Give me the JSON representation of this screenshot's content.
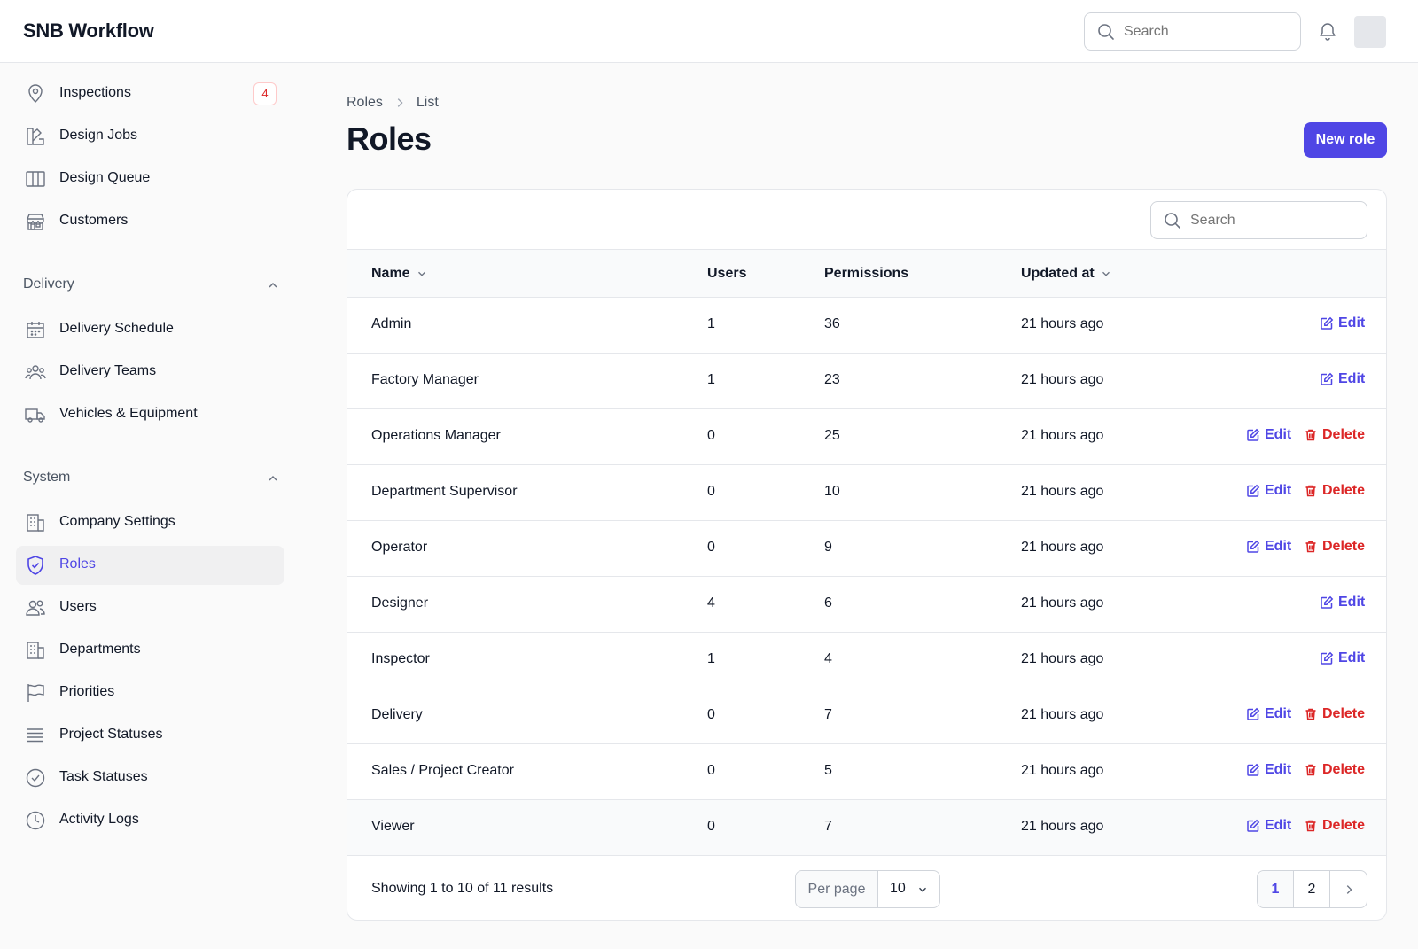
{
  "app": {
    "title": "SNB Workflow"
  },
  "header": {
    "search_placeholder": "Search"
  },
  "sidebar": {
    "items": [
      {
        "label": "Inspections",
        "icon": "map-pin-icon",
        "badge": "4"
      },
      {
        "label": "Design Jobs",
        "icon": "design-icon"
      },
      {
        "label": "Design Queue",
        "icon": "columns-icon"
      },
      {
        "label": "Customers",
        "icon": "store-icon"
      }
    ],
    "groups": [
      {
        "label": "Delivery",
        "items": [
          {
            "label": "Delivery Schedule",
            "icon": "calendar-icon"
          },
          {
            "label": "Delivery Teams",
            "icon": "users-group-icon"
          },
          {
            "label": "Vehicles & Equipment",
            "icon": "truck-icon"
          }
        ]
      },
      {
        "label": "System",
        "items": [
          {
            "label": "Company Settings",
            "icon": "building-icon"
          },
          {
            "label": "Roles",
            "icon": "shield-check-icon",
            "active": true
          },
          {
            "label": "Users",
            "icon": "users-icon"
          },
          {
            "label": "Departments",
            "icon": "building-icon"
          },
          {
            "label": "Priorities",
            "icon": "flag-icon"
          },
          {
            "label": "Project Statuses",
            "icon": "list-icon"
          },
          {
            "label": "Task Statuses",
            "icon": "check-circle-icon"
          },
          {
            "label": "Activity Logs",
            "icon": "clock-icon"
          }
        ]
      }
    ]
  },
  "breadcrumb": {
    "items": [
      "Roles",
      "List"
    ]
  },
  "page": {
    "title": "Roles",
    "new_button": "New role"
  },
  "table": {
    "search_placeholder": "Search",
    "columns": {
      "name": "Name",
      "users": "Users",
      "permissions": "Permissions",
      "updated": "Updated at"
    },
    "edit_label": "Edit",
    "delete_label": "Delete",
    "rows": [
      {
        "name": "Admin",
        "users": "1",
        "permissions": "36",
        "updated": "21 hours ago",
        "deletable": false
      },
      {
        "name": "Factory Manager",
        "users": "1",
        "permissions": "23",
        "updated": "21 hours ago",
        "deletable": false
      },
      {
        "name": "Operations Manager",
        "users": "0",
        "permissions": "25",
        "updated": "21 hours ago",
        "deletable": true
      },
      {
        "name": "Department Supervisor",
        "users": "0",
        "permissions": "10",
        "updated": "21 hours ago",
        "deletable": true
      },
      {
        "name": "Operator",
        "users": "0",
        "permissions": "9",
        "updated": "21 hours ago",
        "deletable": true
      },
      {
        "name": "Designer",
        "users": "4",
        "permissions": "6",
        "updated": "21 hours ago",
        "deletable": false
      },
      {
        "name": "Inspector",
        "users": "1",
        "permissions": "4",
        "updated": "21 hours ago",
        "deletable": false
      },
      {
        "name": "Delivery",
        "users": "0",
        "permissions": "7",
        "updated": "21 hours ago",
        "deletable": true
      },
      {
        "name": "Sales / Project Creator",
        "users": "0",
        "permissions": "5",
        "updated": "21 hours ago",
        "deletable": true
      },
      {
        "name": "Viewer",
        "users": "0",
        "permissions": "7",
        "updated": "21 hours ago",
        "deletable": true
      }
    ]
  },
  "footer": {
    "showing": "Showing 1 to 10 of 11 results",
    "per_page_label": "Per page",
    "per_page_value": "10",
    "pages": [
      "1",
      "2"
    ]
  },
  "colors": {
    "accent": "#4f46e5",
    "danger": "#dc2626"
  }
}
